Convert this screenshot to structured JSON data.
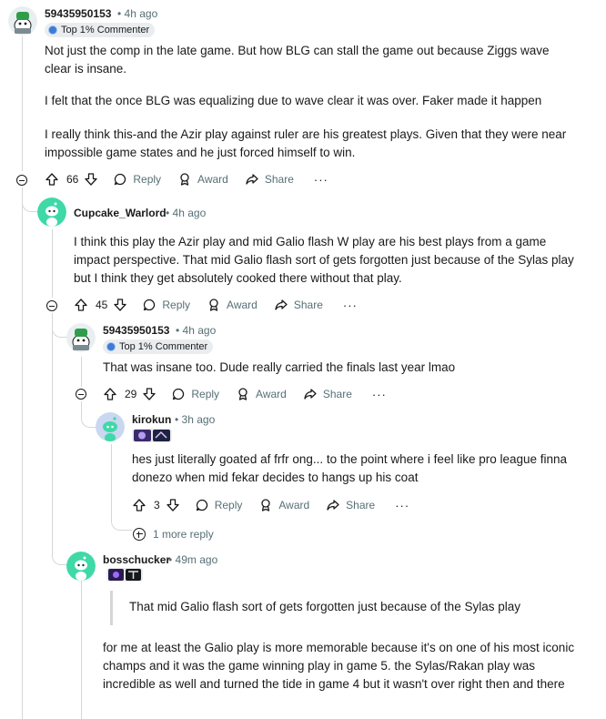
{
  "comments": [
    {
      "author": "59435950153",
      "time": "4h ago",
      "badge": "Top 1% Commenter",
      "paragraphs": [
        "Not just the comp in the late game. But how BLG can stall the game out because Ziggs wave clear is insane.",
        "I felt that the once BLG was equalizing due to wave clear it was over. Faker made it happen",
        "I really think this-and the Azir play against ruler are his greatest plays. Given that they were near impossible game states and he just forced himself to win."
      ],
      "votes": "66"
    },
    {
      "author": "Cupcake_Warlord",
      "time": "4h ago",
      "paragraphs": [
        "I think this play the Azir play and mid Galio flash W play are his best plays from a game impact perspective. That mid Galio flash sort of gets forgotten just because of the Sylas play but I think they get absolutely cooked there without that play."
      ],
      "votes": "45"
    },
    {
      "author": "59435950153",
      "time": "4h ago",
      "badge": "Top 1% Commenter",
      "paragraphs": [
        "That was insane too. Dude really carried the finals last year lmao"
      ],
      "votes": "29"
    },
    {
      "author": "kirokun",
      "time": "3h ago",
      "paragraphs": [
        "hes just literally goated af frfr ong... to the point where i feel like pro league finna donezo when mid fekar decides to hangs up his coat"
      ],
      "votes": "3"
    },
    {
      "author": "bosschucker",
      "time": "49m ago",
      "quote": "That mid Galio flash sort of gets forgotten just because of the Sylas play",
      "paragraphs": [
        "for me at least the Galio play is more memorable because it's on one of his most iconic champs and it was the game winning play in game 5. the Sylas/Rakan play was incredible as well and turned the tide in game 4 but it wasn't over right then and there"
      ]
    }
  ],
  "actions": {
    "reply": "Reply",
    "award": "Award",
    "share": "Share",
    "more": "···",
    "sep": "•"
  },
  "more_replies": "1 more reply",
  "colors": {
    "avatar_green": "#3ed9a7",
    "badge_blue": "#3d7bd6",
    "thread_line": "#d4d7da",
    "meta_text": "#576f76"
  }
}
